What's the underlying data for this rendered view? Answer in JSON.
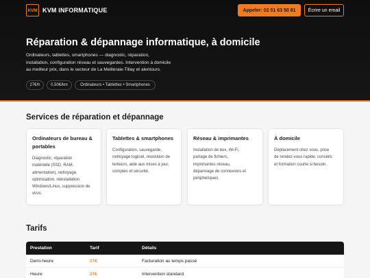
{
  "header": {
    "logo_text": "KVM",
    "brand": "KVM INFORMATIQUE",
    "call_button": "Appeler: 02 51 63 50 81",
    "email_button": "Écrire un email"
  },
  "hero": {
    "title": "Réparation & dépannage informatique, à domicile",
    "description_lines": [
      "Ordinateurs, tablettes, smartphones — diagnostic, réparation,",
      "installation, configuration réseau et sauvegardes. Intervention à domicile",
      "au meilleur prix, dans le secteur de La Meilleraie-Tillay et alentours."
    ],
    "chips": [
      "27€/h",
      "0,50€/km",
      "Ordinateurs • Tablettes • Smartphones"
    ]
  },
  "services": {
    "title": "Services de réparation et dépannage",
    "cards": [
      {
        "title_lines": [
          "Ordinateurs de bureau &",
          "portables"
        ],
        "body_lines": [
          "Diagnostic, réparation",
          "matérielle (SSD, RAM,",
          "alimentation), nettoyage,",
          "optimisation, réinstallation",
          "Windows/Linux, suppression de",
          "virus."
        ]
      },
      {
        "title_lines": [
          "Tablettes & smartphones"
        ],
        "body_lines": [
          "Configuration, sauvegarde,",
          "nettoyage logiciel, résolution de",
          "lenteurs, aide aux mises à jour,",
          "comptes et sécurité."
        ]
      },
      {
        "title_lines": [
          "Réseau & imprimantes"
        ],
        "body_lines": [
          "Installation de box, Wi-Fi,",
          "partage de fichiers,",
          "imprimantes réseau,",
          "dépannage de connexions et",
          "périphériques."
        ]
      },
      {
        "title_lines": [
          "À domicile"
        ],
        "body_lines": [
          "Déplacement chez vous, prise",
          "de rendez-vous rapide, conseils",
          "et formation courte si besoin."
        ]
      }
    ]
  },
  "tarifs": {
    "title": "Tarifs",
    "columns": [
      "Prestation",
      "Tarif",
      "Détails"
    ],
    "rows": [
      {
        "prestation": "Demi-heure",
        "tarif": "17€",
        "details": "Facturation au temps passé"
      },
      {
        "prestation": "Heure",
        "tarif": "27€",
        "details": "Intervention standard"
      }
    ]
  },
  "colors": {
    "accent": "#f27b20",
    "dark": "#121212"
  }
}
